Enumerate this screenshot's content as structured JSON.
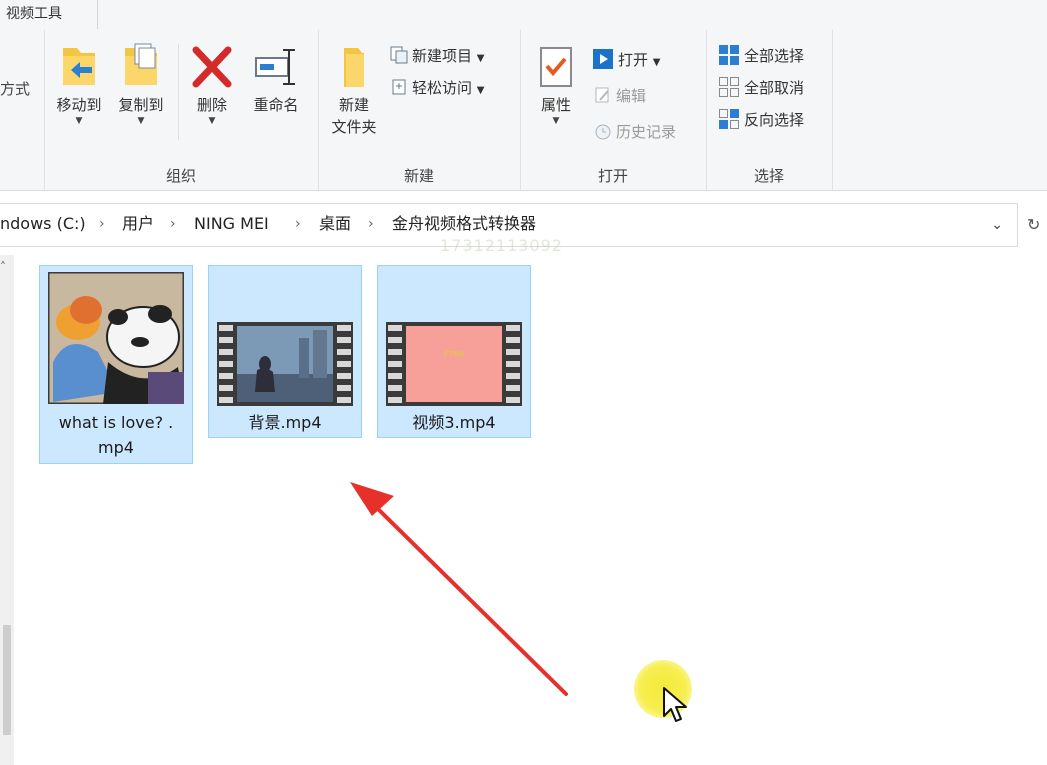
{
  "tabs": {
    "video_tools": "视频工具"
  },
  "ribbon": {
    "left_partial_label": "方式",
    "organize": {
      "label": "组织",
      "move_to": "移动到",
      "copy_to": "复制到",
      "delete": "删除",
      "rename": "重命名"
    },
    "new": {
      "label": "新建",
      "new_folder_line1": "新建",
      "new_folder_line2": "文件夹",
      "new_item": "新建项目",
      "easy_access": "轻松访问"
    },
    "open": {
      "label": "打开",
      "properties": "属性",
      "open": "打开",
      "edit": "编辑",
      "history": "历史记录"
    },
    "select": {
      "label": "选择",
      "select_all": "全部选择",
      "select_none": "全部取消",
      "invert": "反向选择"
    }
  },
  "address": {
    "crumbs": [
      "ndows (C:)",
      "用户",
      "NING MEI",
      "桌面",
      "金舟视频格式转换器"
    ]
  },
  "files": [
    {
      "name_line1": "what is love? .",
      "name_line2": "mp4"
    },
    {
      "name": "背景.mp4"
    },
    {
      "name": "视频3.mp4",
      "thumb_text": "CTOA"
    }
  ],
  "watermark": "17312113092",
  "colors": {
    "selection": "#cce8ff",
    "selection_border": "#99d1ff",
    "arrow": "#e8302a",
    "delete_x": "#d42a2a",
    "highlight": "#f4ea3a"
  }
}
